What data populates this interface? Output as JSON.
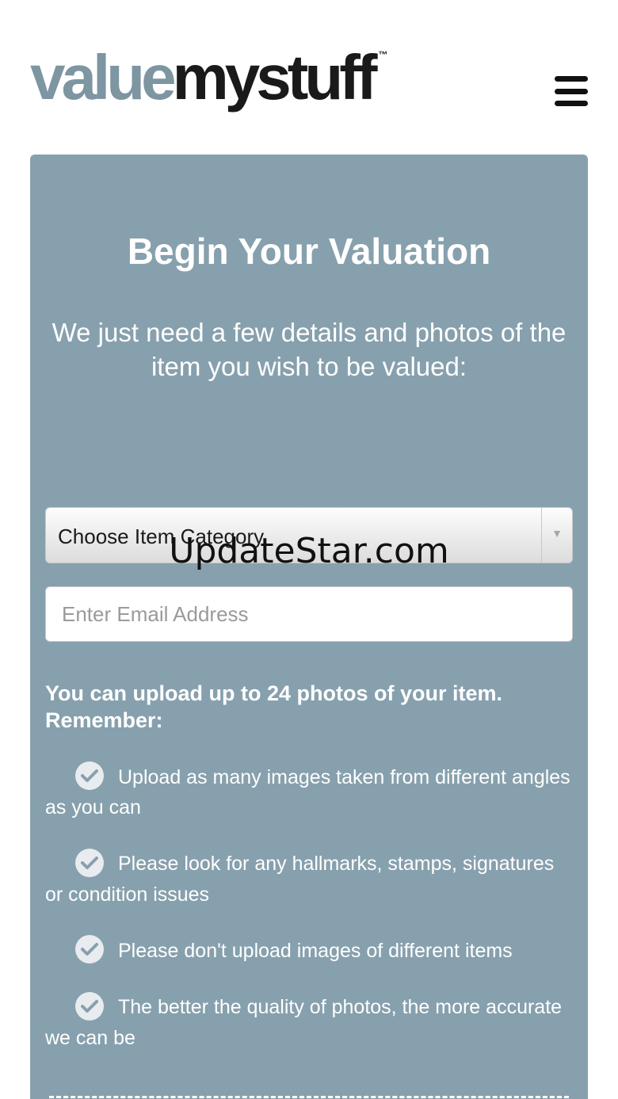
{
  "header": {
    "logo_part1": "value",
    "logo_part2": "mystuff",
    "logo_tm": "™",
    "menu_icon": "hamburger-menu-icon"
  },
  "form": {
    "title": "Begin Your Valuation",
    "subtitle": "We just need a few details and photos of the item you wish to be valued:",
    "category_select": "Choose Item Category",
    "email_placeholder": "Enter Email Address",
    "upload_heading": "You can upload up to 24 photos of your item. Remember:",
    "tips": [
      "Upload as many images taken from different angles as you can",
      "Please look for any hallmarks, stamps, signatures or condition issues",
      "Please don't upload images of different items",
      "The better the quality of photos, the more accurate we can be"
    ]
  },
  "watermark": "UpdateStar.com",
  "colors": {
    "panel": "#87a0ad",
    "logo_accent": "#7e95a2",
    "logo_dark": "#1a1a1a"
  }
}
